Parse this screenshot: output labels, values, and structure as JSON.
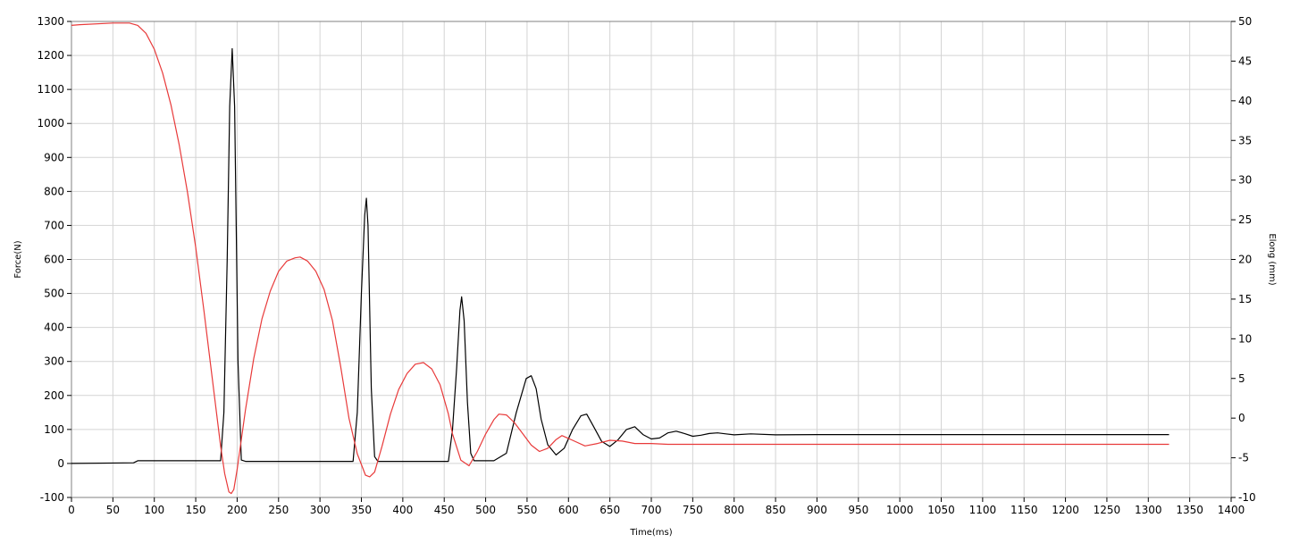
{
  "chart_data": {
    "type": "line",
    "xlabel": "Time(ms)",
    "ylabel_left": "Force(N)",
    "ylabel_right": "Elong (mm)",
    "xlim": [
      0,
      1400
    ],
    "ylim_left": [
      -100,
      1300
    ],
    "ylim_right": [
      -10,
      50
    ],
    "grid": true,
    "x_ticks": [
      "0",
      "50",
      "100",
      "150",
      "200",
      "250",
      "300",
      "350",
      "400",
      "450",
      "500",
      "550",
      "600",
      "650",
      "700",
      "750",
      "800",
      "850",
      "900",
      "950",
      "1000",
      "1050",
      "1100",
      "1150",
      "1200",
      "1250",
      "1300",
      "1350",
      "1400"
    ],
    "y_left_ticks": [
      "-100",
      "0",
      "100",
      "200",
      "300",
      "400",
      "500",
      "600",
      "700",
      "800",
      "900",
      "1000",
      "1100",
      "1200",
      "1300"
    ],
    "y_right_ticks": [
      "-10",
      "-5",
      "0",
      "5",
      "10",
      "15",
      "20",
      "25",
      "30",
      "35",
      "40",
      "45",
      "50"
    ],
    "series": [
      {
        "axis": "left",
        "color": "#000000",
        "x": [
          0,
          75,
          80,
          180,
          184,
          188,
          191,
          194,
          197,
          201,
          205,
          210,
          340,
          345,
          350,
          354,
          356,
          358,
          362,
          366,
          370,
          455,
          460,
          465,
          469,
          471,
          474,
          478,
          482,
          486,
          510,
          525,
          537,
          549,
          555,
          561,
          567,
          575,
          585,
          595,
          605,
          615,
          622,
          630,
          640,
          650,
          660,
          670,
          680,
          690,
          700,
          710,
          720,
          730,
          740,
          750,
          760,
          770,
          780,
          790,
          800,
          820,
          850,
          900,
          950,
          1000,
          1050,
          1100,
          1150,
          1200,
          1250,
          1300,
          1325
        ],
        "y": [
          0,
          2,
          8,
          8,
          150,
          600,
          1050,
          1220,
          1050,
          300,
          10,
          6,
          6,
          150,
          500,
          730,
          780,
          700,
          220,
          20,
          6,
          6,
          100,
          280,
          450,
          490,
          420,
          180,
          30,
          8,
          8,
          30,
          150,
          250,
          258,
          220,
          130,
          55,
          25,
          45,
          100,
          140,
          145,
          110,
          65,
          50,
          70,
          100,
          108,
          85,
          72,
          75,
          90,
          95,
          88,
          80,
          83,
          88,
          90,
          87,
          84,
          87,
          84,
          85,
          85,
          85,
          85,
          85,
          85,
          85,
          85,
          85,
          85
        ]
      },
      {
        "axis": "right",
        "color": "#e83a3a",
        "x": [
          0,
          10,
          50,
          70,
          80,
          90,
          100,
          110,
          120,
          130,
          140,
          150,
          160,
          170,
          180,
          185,
          190,
          193,
          196,
          200,
          210,
          220,
          230,
          240,
          250,
          260,
          270,
          276,
          285,
          295,
          305,
          315,
          325,
          335,
          345,
          355,
          360,
          366,
          375,
          385,
          395,
          405,
          415,
          425,
          435,
          445,
          455,
          460,
          470,
          480,
          490,
          500,
          510,
          516,
          525,
          535,
          545,
          555,
          565,
          575,
          585,
          592,
          605,
          620,
          635,
          650,
          665,
          680,
          700,
          720,
          750,
          800,
          850,
          900,
          950,
          1000,
          1050,
          1100,
          1150,
          1200,
          1250,
          1300,
          1325
        ],
        "y": [
          49.5,
          49.6,
          49.8,
          49.8,
          49.5,
          48.5,
          46.5,
          43.5,
          39.5,
          34.5,
          28.5,
          21.5,
          13.5,
          5,
          -3.5,
          -7,
          -9.3,
          -9.5,
          -9,
          -6.5,
          1,
          7.5,
          12.5,
          16,
          18.5,
          19.8,
          20.2,
          20.3,
          19.8,
          18.5,
          16.2,
          12.3,
          6.5,
          0,
          -4.5,
          -7.2,
          -7.4,
          -6.8,
          -3.5,
          0.5,
          3.6,
          5.6,
          6.8,
          7,
          6.2,
          4.2,
          0.5,
          -2,
          -5.3,
          -6,
          -4.2,
          -2,
          -0.2,
          0.5,
          0.4,
          -0.6,
          -2,
          -3.4,
          -4.2,
          -3.8,
          -2.7,
          -2.2,
          -2.8,
          -3.5,
          -3.2,
          -2.8,
          -2.9,
          -3.2,
          -3.2,
          -3.3,
          -3.3,
          -3.3,
          -3.3,
          -3.3,
          -3.3,
          -3.3,
          -3.3,
          -3.3,
          -3.3,
          -3.3,
          -3.3,
          -3.3,
          -3.3
        ]
      }
    ]
  }
}
